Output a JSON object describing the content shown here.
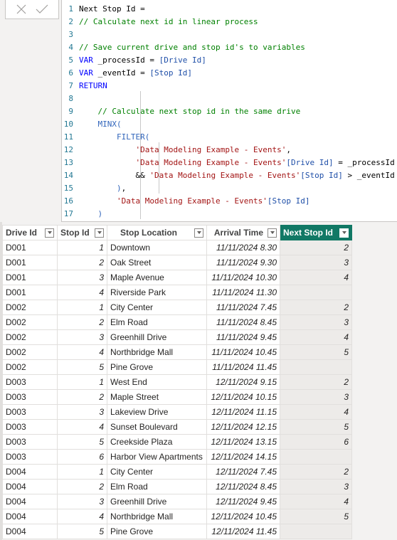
{
  "formula_bar": {
    "cancel_icon": "x-icon",
    "commit_icon": "checkmark-icon",
    "lines": [
      {
        "n": "1",
        "indent": "",
        "tokens": [
          [
            "plain",
            "Next Stop Id ="
          ]
        ]
      },
      {
        "n": "2",
        "indent": "",
        "tokens": [
          [
            "comment",
            "// Calculate next id in linear process"
          ]
        ]
      },
      {
        "n": "3",
        "indent": "",
        "tokens": []
      },
      {
        "n": "4",
        "indent": "",
        "tokens": [
          [
            "comment",
            "// Save current drive and stop id's to variables"
          ]
        ]
      },
      {
        "n": "5",
        "indent": "",
        "tokens": [
          [
            "kw",
            "VAR"
          ],
          [
            "plain",
            " _processId = "
          ],
          [
            "col",
            "[Drive Id]"
          ]
        ]
      },
      {
        "n": "6",
        "indent": "",
        "tokens": [
          [
            "kw",
            "VAR"
          ],
          [
            "plain",
            " _eventId = "
          ],
          [
            "col",
            "[Stop Id]"
          ]
        ]
      },
      {
        "n": "7",
        "indent": "",
        "tokens": [
          [
            "kw",
            "RETURN"
          ]
        ]
      },
      {
        "n": "8",
        "indent": "",
        "tokens": []
      },
      {
        "n": "9",
        "indent": "    ",
        "tokens": [
          [
            "comment",
            "// Calculate next stop id in the same drive"
          ]
        ]
      },
      {
        "n": "10",
        "indent": "    ",
        "tokens": [
          [
            "fn",
            "MINX("
          ]
        ]
      },
      {
        "n": "11",
        "indent": "        ",
        "tokens": [
          [
            "fn",
            "FILTER("
          ]
        ]
      },
      {
        "n": "12",
        "indent": "            ",
        "tokens": [
          [
            "str",
            "'Data Modeling Example - Events'"
          ],
          [
            "plain",
            ","
          ]
        ]
      },
      {
        "n": "13",
        "indent": "            ",
        "tokens": [
          [
            "str",
            "'Data Modeling Example - Events'"
          ],
          [
            "col",
            "[Drive Id]"
          ],
          [
            "plain",
            " = _processId"
          ]
        ]
      },
      {
        "n": "14",
        "indent": "            ",
        "tokens": [
          [
            "plain",
            "&& "
          ],
          [
            "str",
            "'Data Modeling Example - Events'"
          ],
          [
            "col",
            "[Stop Id]"
          ],
          [
            "plain",
            " > _eventId"
          ]
        ]
      },
      {
        "n": "15",
        "indent": "        ",
        "tokens": [
          [
            "fn",
            ")"
          ],
          [
            "plain",
            ","
          ]
        ]
      },
      {
        "n": "16",
        "indent": "        ",
        "tokens": [
          [
            "str",
            "'Data Modeling Example - Events'"
          ],
          [
            "col",
            "[Stop Id]"
          ]
        ]
      },
      {
        "n": "17",
        "indent": "    ",
        "tokens": [
          [
            "fn",
            ")"
          ]
        ]
      }
    ]
  },
  "table": {
    "columns": [
      {
        "label": "Drive Id",
        "highlighted": false
      },
      {
        "label": "Stop Id",
        "highlighted": false
      },
      {
        "label": "Stop Location",
        "highlighted": false
      },
      {
        "label": "Arrival Time",
        "highlighted": false
      },
      {
        "label": "Next Stop Id",
        "highlighted": true
      }
    ],
    "highlight_color": "#117865",
    "rows": [
      [
        "D001",
        "1",
        "Downtown",
        "11/11/2024 8.30",
        "2"
      ],
      [
        "D001",
        "2",
        "Oak Street",
        "11/11/2024 9.30",
        "3"
      ],
      [
        "D001",
        "3",
        "Maple Avenue",
        "11/11/2024 10.30",
        "4"
      ],
      [
        "D001",
        "4",
        "Riverside Park",
        "11/11/2024 11.30",
        ""
      ],
      [
        "D002",
        "1",
        "City Center",
        "11/11/2024 7.45",
        "2"
      ],
      [
        "D002",
        "2",
        "Elm Road",
        "11/11/2024 8.45",
        "3"
      ],
      [
        "D002",
        "3",
        "Greenhill Drive",
        "11/11/2024 9.45",
        "4"
      ],
      [
        "D002",
        "4",
        "Northbridge Mall",
        "11/11/2024 10.45",
        "5"
      ],
      [
        "D002",
        "5",
        "Pine Grove",
        "11/11/2024 11.45",
        ""
      ],
      [
        "D003",
        "1",
        "West End",
        "12/11/2024 9.15",
        "2"
      ],
      [
        "D003",
        "2",
        "Maple Street",
        "12/11/2024 10.15",
        "3"
      ],
      [
        "D003",
        "3",
        "Lakeview Drive",
        "12/11/2024 11.15",
        "4"
      ],
      [
        "D003",
        "4",
        "Sunset Boulevard",
        "12/11/2024 12.15",
        "5"
      ],
      [
        "D003",
        "5",
        "Creekside Plaza",
        "12/11/2024 13.15",
        "6"
      ],
      [
        "D003",
        "6",
        "Harbor View Apartments",
        "12/11/2024 14.15",
        ""
      ],
      [
        "D004",
        "1",
        "City Center",
        "12/11/2024 7.45",
        "2"
      ],
      [
        "D004",
        "2",
        "Elm Road",
        "12/11/2024 8.45",
        "3"
      ],
      [
        "D004",
        "3",
        "Greenhill Drive",
        "12/11/2024 9.45",
        "4"
      ],
      [
        "D004",
        "4",
        "Northbridge Mall",
        "12/11/2024 10.45",
        "5"
      ],
      [
        "D004",
        "5",
        "Pine Grove",
        "12/11/2024 11.45",
        ""
      ]
    ]
  }
}
